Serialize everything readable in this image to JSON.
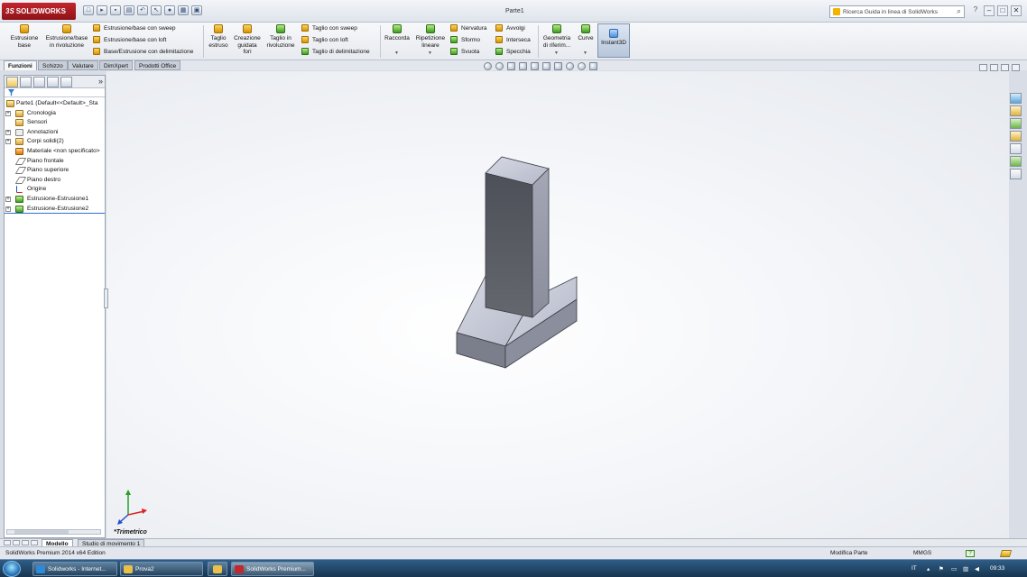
{
  "titlebar": {
    "app_logo": "SOLIDWORKS",
    "logo_prefix": "3S",
    "document_title": "Parte1",
    "help_search_placeholder": "Ricerca Guida in linea di SolidWorks",
    "window_controls": [
      "?",
      "–",
      "□",
      "✕"
    ]
  },
  "command_manager": {
    "estrusione_base": "Estrusione\nbase",
    "estrusione_rivoluzione": "Estrusione/base\nin rivoluzione",
    "estrusione_sweep": "Estrusione/base con sweep",
    "estrusione_loft": "Estrusione/base con loft",
    "estrusione_delimitazione": "Base/Estrusione con delimitazione",
    "taglio_estruso": "Taglio\nestruso",
    "creazione_guidata_fori": "Creazione\nguidata\nfori",
    "taglio_rivoluzione": "Taglio in\nrivoluzione",
    "taglio_sweep": "Taglio con sweep",
    "taglio_loft": "Taglio con loft",
    "taglio_delimitazione": "Taglio di delimitazione",
    "raccorda": "Raccorda",
    "ripetizione_lineare": "Ripetizione\nlineare",
    "nervatura": "Nervatura",
    "sformo": "Sformo",
    "svuota": "Svuota",
    "avvolgi": "Avvolgi",
    "interseca": "Interseca",
    "specchia": "Specchia",
    "geometria_riferimento": "Geometria\ndi riferim...",
    "curve": "Curve",
    "instant3d": "Instant3D"
  },
  "feature_tabs": [
    "Funzioni",
    "Schizzo",
    "Valutare",
    "DimXpert",
    "Prodotti Office"
  ],
  "feature_tree": {
    "root": "Parte1  (Default<<Default>_Sta",
    "items": [
      {
        "label": "Cronologia",
        "icon": "history-icon",
        "expandable": true
      },
      {
        "label": "Sensori",
        "icon": "sensor-icon",
        "expandable": false
      },
      {
        "label": "Annotazioni",
        "icon": "annotation-icon",
        "expandable": true
      },
      {
        "label": "Corpi solidi(2)",
        "icon": "solid-bodies-icon",
        "expandable": true
      },
      {
        "label": "Materiale <non specificato>",
        "icon": "material-icon",
        "expandable": false
      },
      {
        "label": "Piano frontale",
        "icon": "plane-icon",
        "expandable": false
      },
      {
        "label": "Piano superiore",
        "icon": "plane-icon",
        "expandable": false
      },
      {
        "label": "Piano destro",
        "icon": "plane-icon",
        "expandable": false
      },
      {
        "label": "Origine",
        "icon": "origin-icon",
        "expandable": false
      },
      {
        "label": "Estrusione-Estrusione1",
        "icon": "extrude-icon",
        "expandable": true
      },
      {
        "label": "Estrusione-Estrusione2",
        "icon": "extrude-icon",
        "expandable": true
      }
    ]
  },
  "viewport": {
    "orientation_label": "*Trimetrico",
    "model_colors": {
      "top": "#c4c8d6",
      "left": "#5a5c66",
      "right": "#9a9dac",
      "front": "#7b7e8b",
      "end": "#8b8e9c"
    }
  },
  "bottom_tabs": [
    "Modello",
    "Studio di movimento 1"
  ],
  "status_bar": {
    "product": "SolidWorks Premium 2014 x64 Edition",
    "mode": "Modifica Parte",
    "units": "MMGS"
  },
  "taskbar": {
    "buttons": [
      {
        "label": "Solidworks - Internet...",
        "color": "#2d8ad6"
      },
      {
        "label": "Prova2",
        "color": "#e8c04a"
      },
      {
        "label": "",
        "color": "#e8c04a"
      },
      {
        "label": "SolidWorks Premium...",
        "color": "#c1272d"
      }
    ],
    "language": "IT",
    "time": "09:33"
  }
}
